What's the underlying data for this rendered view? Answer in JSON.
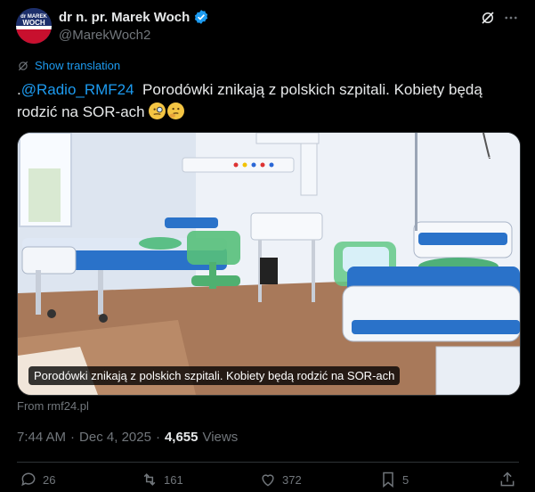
{
  "header": {
    "display_name": "dr n. pr. Marek Woch",
    "handle": "@MarekWoch2",
    "avatar_text": "dr MAREK WOCH"
  },
  "translation": {
    "label": "Show translation"
  },
  "tweet": {
    "prefix": ".",
    "mention": "@Radio_RMF24",
    "text": "  Porodówki znikają z polskich szpitali. Kobiety będą rodzić na SOR-ach"
  },
  "media": {
    "caption": "Porodówki znikają z polskich szpitali. Kobiety będą rodzić na SOR-ach",
    "source": "From rmf24.pl"
  },
  "meta": {
    "time": "7:44 AM",
    "sep": "·",
    "date": "Dec 4, 2025",
    "views_count": "4,655",
    "views_label": "Views"
  },
  "actions": {
    "replies": "26",
    "reposts": "161",
    "likes": "372",
    "bookmarks": "5"
  },
  "colors": {
    "background": "#000000",
    "text": "#e7e9ea",
    "muted": "#71767b",
    "accent": "#1d9bf0",
    "divider": "#2f3336"
  },
  "icons": [
    "verified-badge-icon",
    "grok-icon",
    "more-icon",
    "translate-icon",
    "reply-icon",
    "repost-icon",
    "like-icon",
    "bookmark-icon",
    "share-icon"
  ]
}
